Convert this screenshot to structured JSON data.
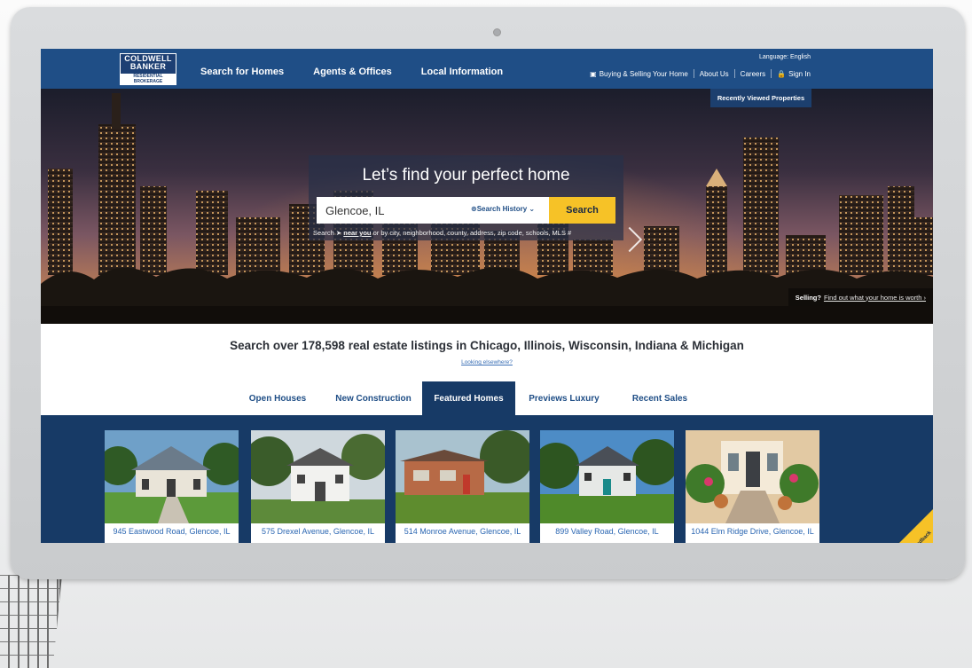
{
  "header": {
    "logo": {
      "line1": "COLDWELL",
      "line2": "BANKER",
      "line3": "RESIDENTIAL BROKERAGE"
    },
    "nav": [
      "Search for Homes",
      "Agents & Offices",
      "Local Information"
    ],
    "language": "Language: English",
    "util": {
      "buying_selling": "Buying & Selling Your Home",
      "about": "About Us",
      "careers": "Careers",
      "sign_in": "Sign In"
    }
  },
  "hero": {
    "recently_viewed": "Recently Viewed Properties",
    "title": "Let’s find your perfect home",
    "search_value": "Glencoe, IL",
    "search_history": "Search History",
    "search_button": "Search",
    "hint_prefix": "Search",
    "hint_near": "near you",
    "hint_suffix": "or by city, neighborhood, county, address, zip code, schools, MLS #",
    "selling_label": "Selling?",
    "selling_link": "Find out what your home is worth ›"
  },
  "listings": {
    "headline": "Search over 178,598 real estate listings in Chicago, Illinois, Wisconsin, Indiana & Michigan",
    "elsewhere": "Looking elsewhere?",
    "tabs": [
      "Open Houses",
      "New Construction",
      "Featured Homes",
      "Previews Luxury",
      "Recent Sales"
    ],
    "active_tab": "Featured Homes",
    "cards": [
      {
        "address": "945 Eastwood Road, Glencoe, IL"
      },
      {
        "address": "575 Drexel Avenue, Glencoe, IL"
      },
      {
        "address": "514 Monroe Avenue, Glencoe, IL"
      },
      {
        "address": "899 Valley Road, Glencoe, IL"
      },
      {
        "address": "1044 Elm Ridge Drive, Glencoe, IL"
      }
    ],
    "feedback": "Feedback"
  },
  "colors": {
    "brand": "#1f4e86",
    "accent": "#f6c227",
    "dark": "#173a66"
  }
}
